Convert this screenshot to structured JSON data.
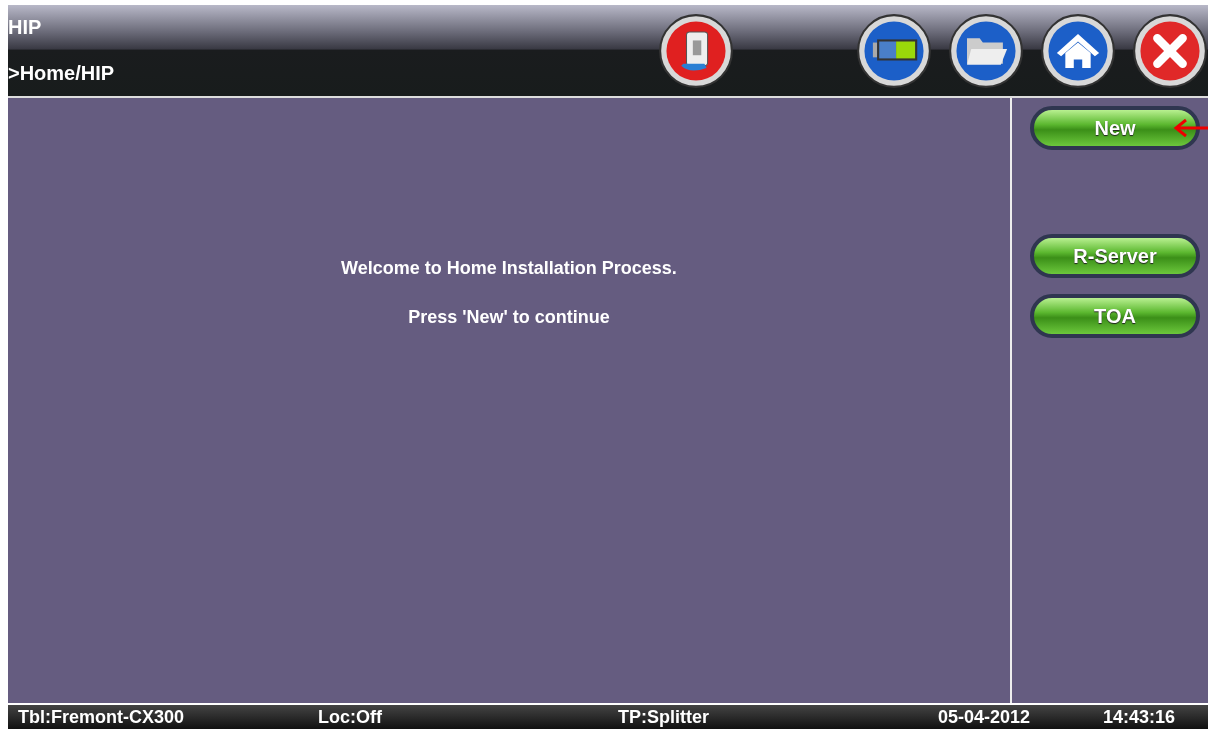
{
  "window": {
    "title": "HIP"
  },
  "breadcrumb": ">Home/HIP",
  "toolbar": [
    {
      "kind": "device"
    },
    {
      "kind": "battery"
    },
    {
      "kind": "folder"
    },
    {
      "kind": "home"
    },
    {
      "kind": "close"
    }
  ],
  "messages": [
    "Welcome to Home Installation Process.",
    "Press 'New' to continue"
  ],
  "side_buttons": [
    {
      "label": "New",
      "pointer": true
    },
    {
      "label": "R-Server",
      "pointer": false
    },
    {
      "label": "TOA",
      "pointer": false
    }
  ],
  "status_bar": [
    "Tbl:Fremont-CX300",
    "Loc:Off",
    "TP:Splitter",
    "05-04-2012",
    "14:43:16"
  ]
}
